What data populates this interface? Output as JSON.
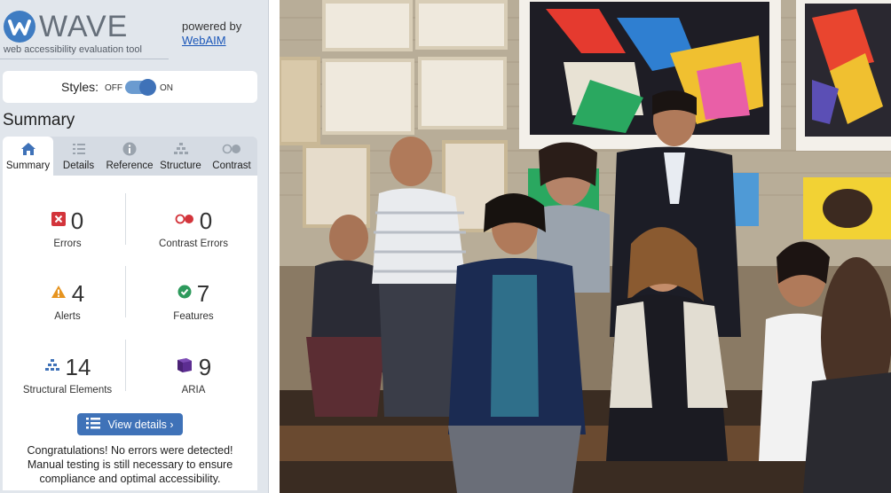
{
  "brand": {
    "name": "WAVE",
    "tagline": "web accessibility evaluation tool",
    "powered_by": "powered by",
    "powered_link": "WebAIM"
  },
  "styles_toggle": {
    "label": "Styles:",
    "off": "OFF",
    "on": "ON",
    "state": "on"
  },
  "summary_heading": "Summary",
  "tabs": [
    {
      "label": "Summary",
      "icon": "home-icon",
      "active": true
    },
    {
      "label": "Details",
      "icon": "list-icon",
      "active": false
    },
    {
      "label": "Reference",
      "icon": "info-icon",
      "active": false
    },
    {
      "label": "Structure",
      "icon": "structure-icon",
      "active": false
    },
    {
      "label": "Contrast",
      "icon": "contrast-icon",
      "active": false
    }
  ],
  "stats": [
    {
      "count": "0",
      "label": "Errors",
      "icon": "error-icon",
      "color": "#d3343b"
    },
    {
      "count": "0",
      "label": "Contrast Errors",
      "icon": "contrast-error-icon",
      "color": "#d3343b"
    },
    {
      "count": "4",
      "label": "Alerts",
      "icon": "alert-icon",
      "color": "#e69420"
    },
    {
      "count": "7",
      "label": "Features",
      "icon": "feature-icon",
      "color": "#2d9a5c"
    },
    {
      "count": "14",
      "label": "Structural Elements",
      "icon": "structural-icon",
      "color": "#3f72b8"
    },
    {
      "count": "9",
      "label": "ARIA",
      "icon": "aria-icon",
      "color": "#5c2d91"
    }
  ],
  "view_details_label": "View details ›",
  "congrats_message": "Congratulations! No errors were detected! Manual testing is still necessary to ensure compliance and optimal accessibility.",
  "colors": {
    "accent": "#3f72b8",
    "sidebar_bg": "#e1e6ec"
  }
}
